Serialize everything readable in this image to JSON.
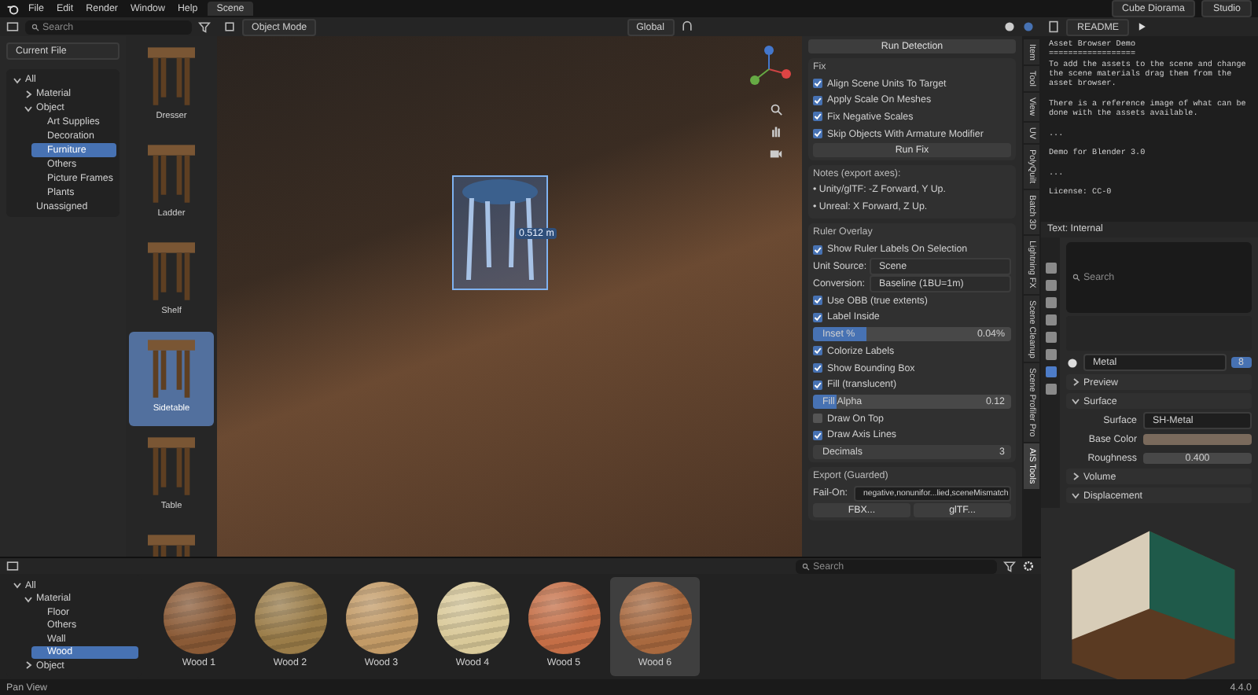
{
  "menu": {
    "items": [
      "File",
      "Edit",
      "Render",
      "Window",
      "Help"
    ],
    "workspace_tab": "Scene"
  },
  "scene": {
    "value": "Cube Diorama"
  },
  "view_layer": {
    "value": "Studio"
  },
  "asset_browser_top": {
    "search_placeholder": "Search",
    "library": "Current File",
    "tree": [
      {
        "label": "All",
        "expanded": true,
        "selected": false,
        "children": [
          {
            "label": "Material",
            "expanded": false,
            "selected": false
          },
          {
            "label": "Object",
            "expanded": true,
            "selected": false,
            "children": [
              {
                "label": "Art Supplies",
                "selected": false
              },
              {
                "label": "Decoration",
                "selected": false
              },
              {
                "label": "Furniture",
                "selected": true
              },
              {
                "label": "Others",
                "selected": false
              },
              {
                "label": "Picture Frames",
                "selected": false
              },
              {
                "label": "Plants",
                "selected": false
              }
            ]
          },
          {
            "label": "Unassigned",
            "selected": false
          }
        ]
      }
    ],
    "assets": [
      {
        "name": "Dresser",
        "selected": false
      },
      {
        "name": "Ladder",
        "selected": false
      },
      {
        "name": "Shelf",
        "selected": false
      },
      {
        "name": "Sidetable",
        "selected": true
      },
      {
        "name": "Table",
        "selected": false
      },
      {
        "selected": false
      }
    ]
  },
  "viewport": {
    "mode": "Object Mode",
    "orientation": "Global",
    "measure_label": "0.512 m"
  },
  "n_panel": {
    "run_detection": "Run Detection",
    "fix": {
      "title": "Fix",
      "checks": [
        {
          "label": "Align Scene Units To Target",
          "checked": true
        },
        {
          "label": "Apply Scale On Meshes",
          "checked": true
        },
        {
          "label": "Fix Negative Scales",
          "checked": true
        },
        {
          "label": "Skip Objects With Armature Modifier",
          "checked": true
        }
      ],
      "button": "Run Fix"
    },
    "notes": {
      "title": "Notes (export axes):",
      "lines": [
        "• Unity/glTF: -Z Forward, Y Up.",
        "• Unreal: X Forward, Z Up."
      ]
    },
    "ruler": {
      "title": "Ruler Overlay",
      "rows": [
        {
          "kind": "checkbox",
          "label": "Show Ruler Labels On Selection",
          "checked": true
        },
        {
          "kind": "dropdown",
          "label": "Unit Source:",
          "value": "Scene"
        },
        {
          "kind": "dropdown",
          "label": "Conversion:",
          "value": "Baseline (1BU=1m)"
        },
        {
          "kind": "checkbox",
          "label": "Use OBB (true extents)",
          "checked": true
        },
        {
          "kind": "checkbox",
          "label": "Label Inside",
          "checked": true
        },
        {
          "kind": "slider",
          "label": "Inset %",
          "value": "0.04%",
          "level": 0.27
        },
        {
          "kind": "checkbox",
          "label": "Colorize Labels",
          "checked": true
        },
        {
          "kind": "checkbox",
          "label": "Show Bounding Box",
          "checked": true
        },
        {
          "kind": "checkbox",
          "label": "Fill (translucent)",
          "checked": true
        },
        {
          "kind": "slider",
          "label": "Fill Alpha",
          "value": "0.12",
          "level": 0.12
        },
        {
          "kind": "checkbox",
          "label": "Draw On Top",
          "checked": false
        },
        {
          "kind": "checkbox",
          "label": "Draw Axis Lines",
          "checked": true
        },
        {
          "kind": "number",
          "label": "Decimals",
          "value": "3"
        }
      ]
    },
    "export": {
      "title": "Export (Guarded)",
      "fail_on_label": "Fail-On:",
      "fail_on_value": "negative,nonunifor...lied,sceneMismatch",
      "buttons": [
        "FBX...",
        "glTF..."
      ]
    }
  },
  "side_tabs": [
    {
      "label": "Item",
      "selected": false
    },
    {
      "label": "Tool",
      "selected": false
    },
    {
      "label": "View",
      "selected": false
    },
    {
      "label": "UV",
      "selected": false
    },
    {
      "label": "PolyQuilt",
      "selected": false
    },
    {
      "label": "Batch 3D",
      "selected": false
    },
    {
      "label": "Lightning FX",
      "selected": false
    },
    {
      "label": "Scene Cleanup",
      "selected": false
    },
    {
      "label": "Scene Profiler Pro",
      "selected": false
    },
    {
      "label": "AIS Tools",
      "selected": true
    }
  ],
  "text_editor": {
    "file": "README",
    "paragraphs": [
      [
        "Asset Browser Demo",
        "==================",
        "To add the assets to the scene and change",
        "the scene materials drag them from the",
        "asset browser."
      ],
      [
        "There is a reference image of what can be",
        "done with the assets available."
      ],
      [
        "..."
      ],
      [
        "Demo for Blender 3.0"
      ],
      [
        "..."
      ],
      [
        "License: CC-0"
      ]
    ],
    "footer": "Text: Internal"
  },
  "properties": {
    "search_placeholder": "Search",
    "material": "Metal",
    "users": "8",
    "sections": [
      {
        "title": "Preview",
        "expanded": false
      },
      {
        "title": "Surface",
        "expanded": true,
        "fields": [
          {
            "label": "Surface",
            "kind": "shader",
            "value": "SH-Metal"
          },
          {
            "label": "Base Color",
            "kind": "color",
            "color": "#7a6a5c"
          },
          {
            "label": "Roughness",
            "kind": "number",
            "value": "0.400"
          }
        ]
      },
      {
        "title": "Volume",
        "expanded": false
      },
      {
        "title": "Displacement",
        "expanded": true
      }
    ]
  },
  "asset_browser_bottom": {
    "search_placeholder": "Search",
    "tree": [
      {
        "label": "All",
        "expanded": true,
        "selected": false,
        "children": [
          {
            "label": "Material",
            "expanded": true,
            "selected": false,
            "children": [
              {
                "label": "Floor",
                "selected": false
              },
              {
                "label": "Others",
                "selected": false
              },
              {
                "label": "Wall",
                "selected": false
              },
              {
                "label": "Wood",
                "selected": true
              }
            ]
          },
          {
            "label": "Object",
            "expanded": false,
            "selected": false
          }
        ]
      }
    ],
    "materials": [
      {
        "name": "Wood 1",
        "color": "#8a5a36",
        "selected": false
      },
      {
        "name": "Wood 2",
        "color": "#9a7c48",
        "selected": false
      },
      {
        "name": "Wood 3",
        "color": "#c29a66",
        "selected": false
      },
      {
        "name": "Wood 4",
        "color": "#d9c999",
        "selected": false
      },
      {
        "name": "Wood 5",
        "color": "#c46e46",
        "selected": false
      },
      {
        "name": "Wood 6",
        "color": "#a8693f",
        "selected": true
      }
    ]
  },
  "status_bar": {
    "hint": "Pan View",
    "version": "4.4.0"
  }
}
